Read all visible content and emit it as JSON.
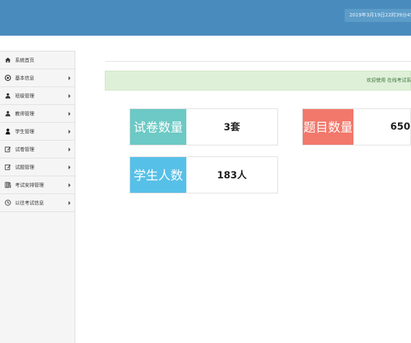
{
  "header": {
    "datetime": "2019年3月19日22时39分45"
  },
  "sidebar": {
    "items": [
      {
        "label": "系统首页",
        "icon": "home-icon",
        "has_arrow": false
      },
      {
        "label": "基本信息",
        "icon": "info-circle-icon",
        "has_arrow": true
      },
      {
        "label": "班级管理",
        "icon": "users-icon",
        "has_arrow": true
      },
      {
        "label": "教师管理",
        "icon": "users-icon",
        "has_arrow": true
      },
      {
        "label": "学生管理",
        "icon": "user-icon",
        "has_arrow": true
      },
      {
        "label": "试卷管理",
        "icon": "edit-icon",
        "has_arrow": true
      },
      {
        "label": "试题管理",
        "icon": "edit-icon",
        "has_arrow": true
      },
      {
        "label": "考试安排管理",
        "icon": "book-icon",
        "has_arrow": true
      },
      {
        "label": "以往考试信息",
        "icon": "clock-icon",
        "has_arrow": true
      }
    ]
  },
  "notice": {
    "text": "欢迎使用 在线考试系"
  },
  "stats": [
    {
      "label": "试卷数量",
      "value": "3套",
      "color": "#6cc9c5"
    },
    {
      "label": "题目数量",
      "value": "650",
      "color": "#f2786b"
    },
    {
      "label": "学生人数",
      "value": "183人",
      "color": "#57c0e8"
    }
  ],
  "colors": {
    "header": "#4a8bbd",
    "notice_bg": "#dff0d8",
    "notice_text": "#3c763d",
    "sidebar_bg": "#f5f5f5"
  }
}
